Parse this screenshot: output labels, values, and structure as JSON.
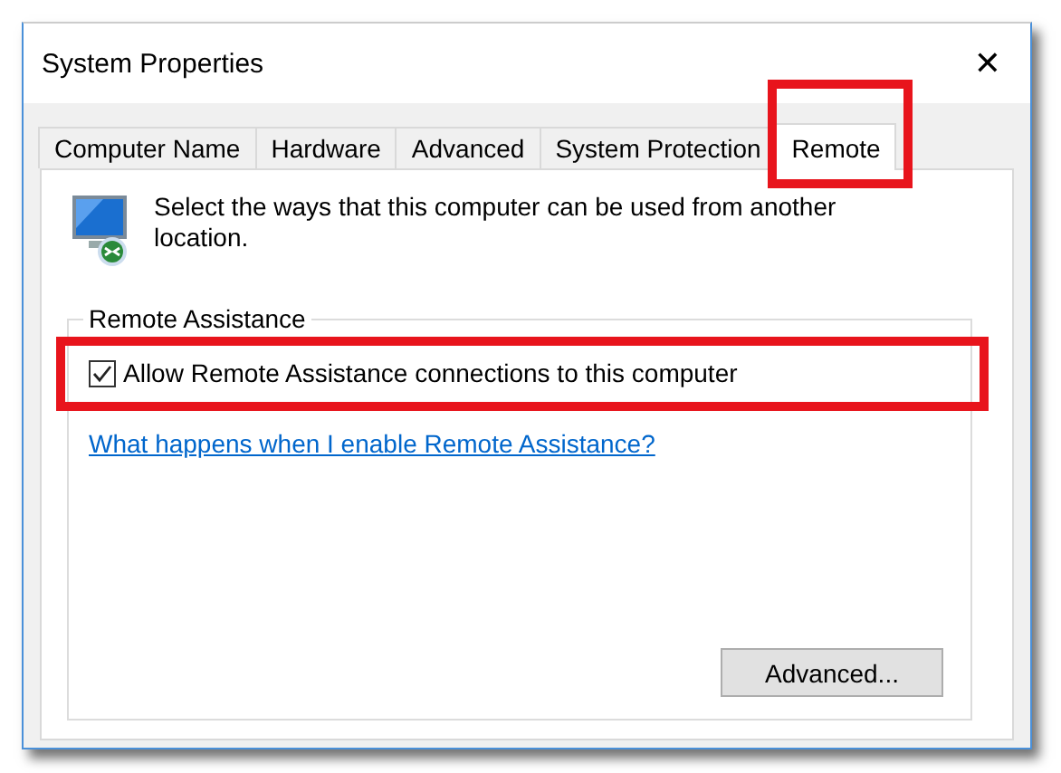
{
  "window": {
    "title": "System Properties",
    "close": "✕"
  },
  "tabs": [
    {
      "label": "Computer Name",
      "selected": false,
      "highlighted": false
    },
    {
      "label": "Hardware",
      "selected": false,
      "highlighted": false
    },
    {
      "label": "Advanced",
      "selected": false,
      "highlighted": false
    },
    {
      "label": "System Protection",
      "selected": false,
      "highlighted": false
    },
    {
      "label": "Remote",
      "selected": true,
      "highlighted": true
    }
  ],
  "intro": "Select the ways that this computer can be used from another location.",
  "remote_assistance": {
    "title": "Remote Assistance",
    "checkbox": {
      "label": "Allow Remote Assistance connections to this computer",
      "checked": true,
      "highlighted": true
    },
    "link": "What happens when I enable Remote Assistance?",
    "button": "Advanced..."
  }
}
